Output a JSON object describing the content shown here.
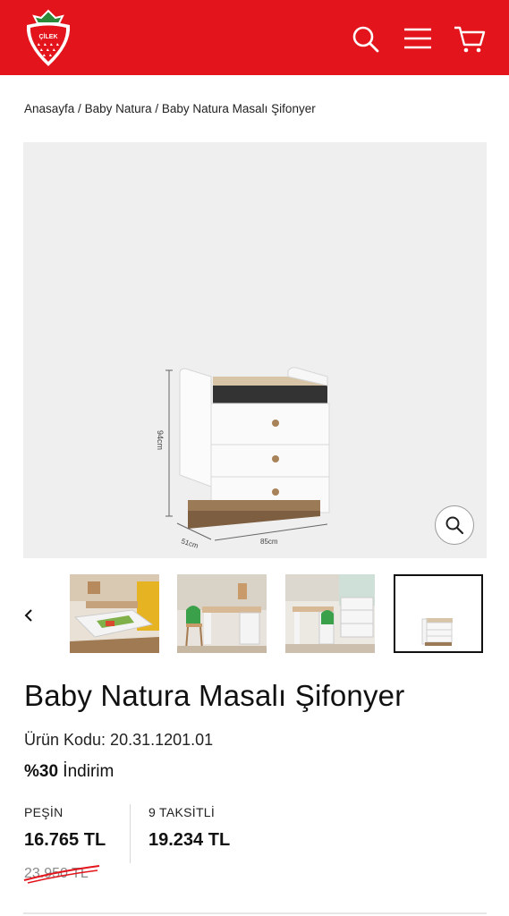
{
  "header": {
    "brand_text": "ÇİLEK",
    "brand_color": "#e3141b",
    "icons": [
      "search-icon",
      "menu-icon",
      "cart-icon"
    ]
  },
  "breadcrumb": {
    "items": [
      "Anasayfa",
      "Baby Natura",
      "Baby Natura Masalı Şifonyer"
    ],
    "separator": " / "
  },
  "product_image": {
    "dim_height": "94cm",
    "dim_depth": "51cm",
    "dim_width": "85cm",
    "zoom_icon": "zoom-icon"
  },
  "gallery": {
    "prev_icon": "chevron-left-icon",
    "thumbnails": [
      "room-scene-drawer",
      "room-scene-desk",
      "room-scene-bedroom",
      "product-white-bg"
    ],
    "selected_index": 3
  },
  "product": {
    "title": "Baby Natura Masalı Şifonyer",
    "code_label": "Ürün Kodu: 20.31.1201.01",
    "discount_value": "%30",
    "discount_label": " İndirim"
  },
  "pricing": {
    "cash_label": "PEŞİN",
    "cash_price": "16.765 TL",
    "installment_label": "9 TAKSİTLİ",
    "installment_price": "19.234 TL",
    "old_price": "23.950 TL",
    "strike_color": "#e3141b"
  }
}
